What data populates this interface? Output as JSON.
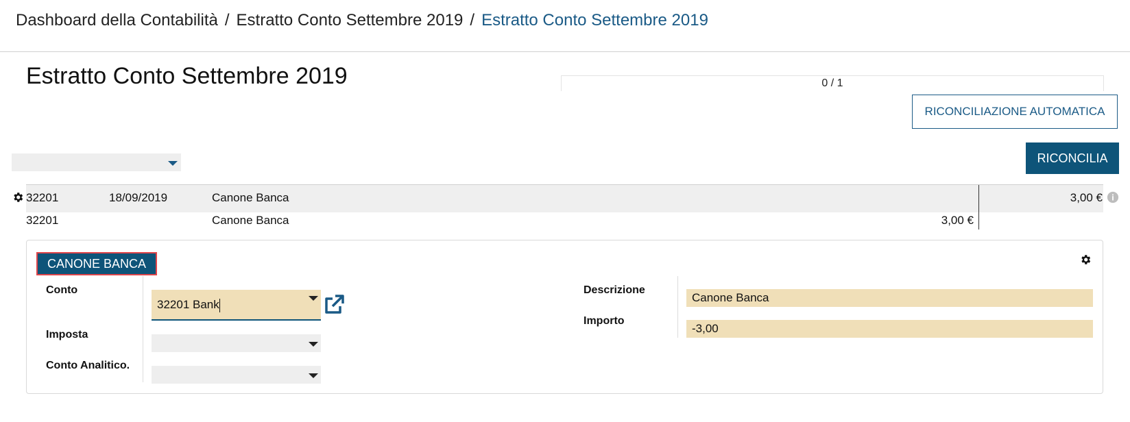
{
  "breadcrumb": {
    "items": [
      "Dashboard della Contabilità",
      "Estratto Conto Settembre 2019"
    ],
    "separator": "/",
    "current": "Estratto Conto Settembre 2019"
  },
  "page": {
    "title": "Estratto Conto Settembre 2019"
  },
  "progress": {
    "text": "0 / 1",
    "done": 0,
    "total": 1
  },
  "buttons": {
    "auto_reconcile": "RICONCILIAZIONE AUTOMATICA",
    "reconcile": "RICONCILIA"
  },
  "statement_line": {
    "account": "32201",
    "date": "18/09/2019",
    "label": "Canone Banca",
    "amount": "3,00 €"
  },
  "proposition_line": {
    "account": "32201",
    "label": "Canone Banca",
    "amount": "3,00 €"
  },
  "panel": {
    "tag": "CANONE BANCA",
    "fields": {
      "conto_label": "Conto",
      "conto_value": "32201 Bank",
      "imposta_label": "Imposta",
      "conto_analitico_label": "Conto Analitico.",
      "descrizione_label": "Descrizione",
      "descrizione_value": "Canone Banca",
      "importo_label": "Importo",
      "importo_value": "-3,00"
    }
  },
  "colors": {
    "primary": "#0e5479",
    "link": "#1a5a86",
    "field_bg": "#f0dfb8",
    "highlight_border": "#e0454a"
  },
  "icons": [
    "gear-icon",
    "info-icon",
    "external-link-icon",
    "caret-down-icon"
  ]
}
